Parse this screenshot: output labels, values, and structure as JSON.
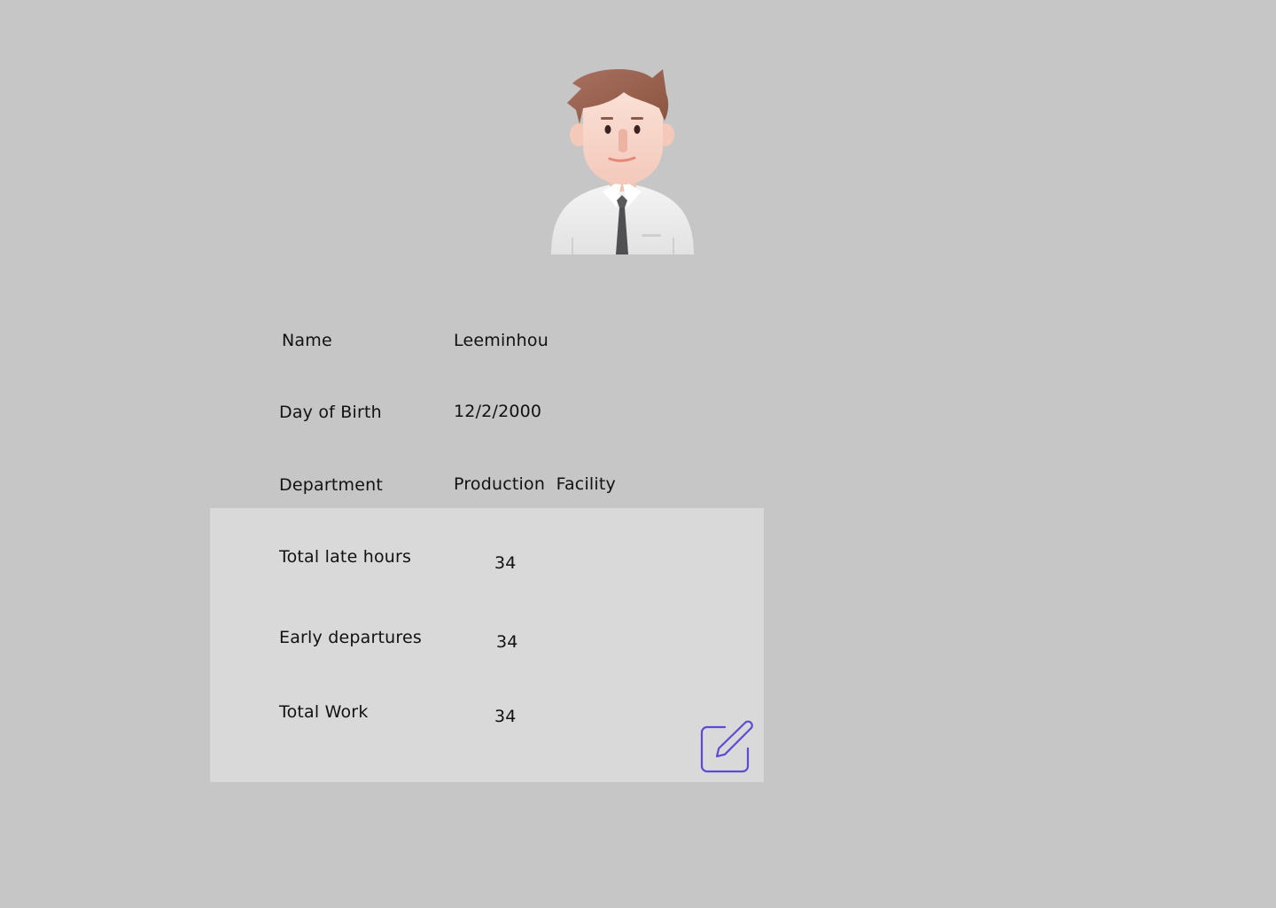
{
  "profile": {
    "avatar_icon": "male-employee-avatar-icon",
    "fields": {
      "name": {
        "label": "Name",
        "value": "Leeminhou"
      },
      "birth": {
        "label": "Day of Birth",
        "value": "12/2/2000"
      },
      "department": {
        "label": "Department",
        "value": "Production  Facility"
      }
    }
  },
  "stats": {
    "late_hours": {
      "label": "Total late hours",
      "value": "34"
    },
    "early_departures": {
      "label": "Early departures",
      "value": "34"
    },
    "total_work": {
      "label": "Total Work",
      "value": "34"
    }
  },
  "actions": {
    "edit_icon": "edit-pencil-icon",
    "edit_color": "#5b4bd6"
  },
  "colors": {
    "background": "#c6c6c6",
    "panel": "#d9d9d9"
  }
}
